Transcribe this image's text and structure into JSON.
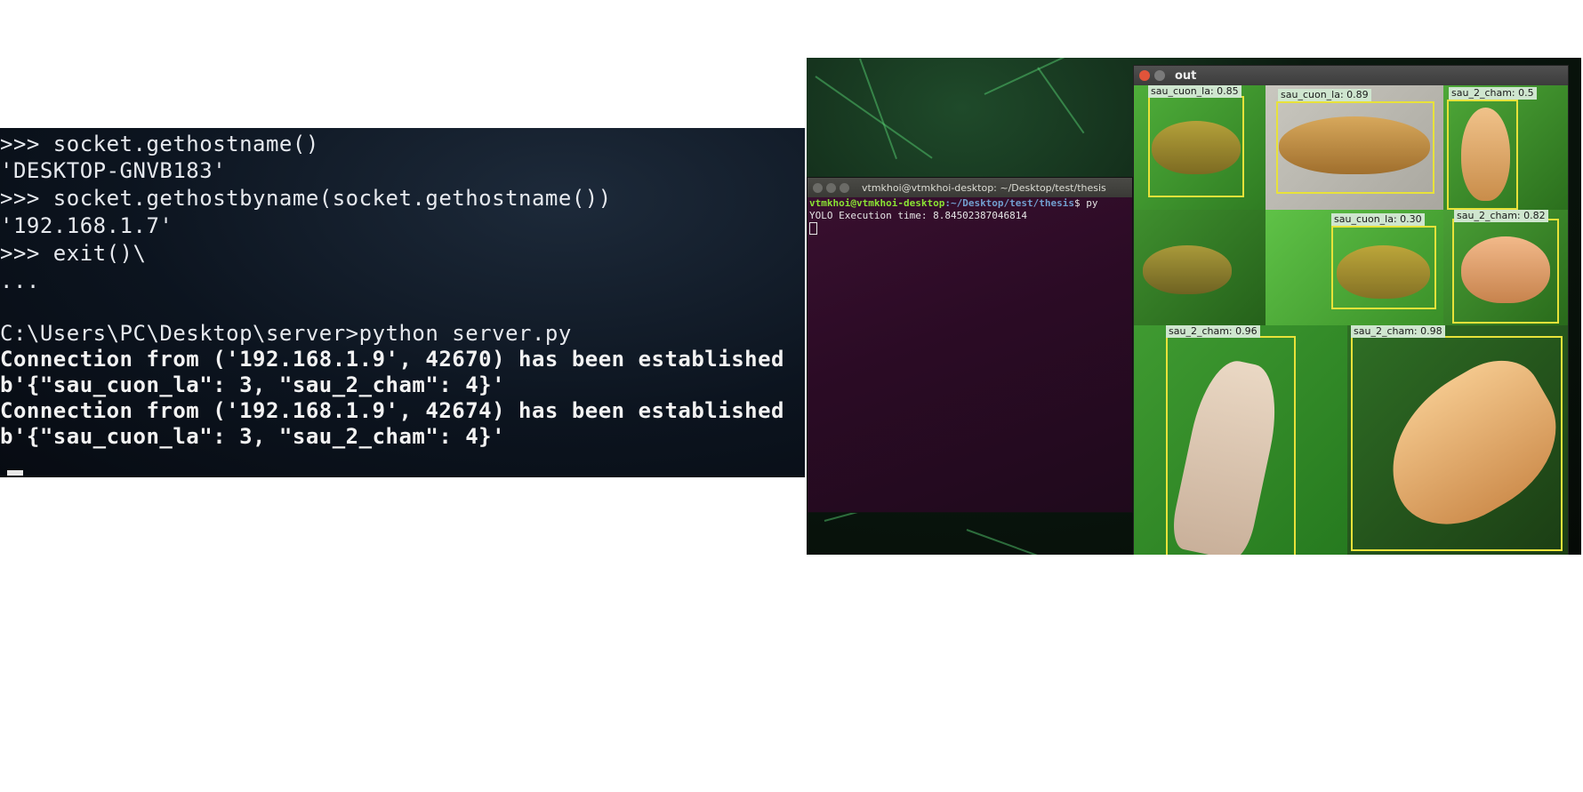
{
  "left_console": {
    "lines": [
      ">>> socket.gethostname()",
      "'DESKTOP-GNVB183'",
      ">>> socket.gethostbyname(socket.gethostname())",
      "'192.168.1.7'",
      ">>> exit()\\",
      "...",
      "",
      "C:\\Users\\PC\\Desktop\\server>python server.py",
      "Connection from ('192.168.1.9', 42670) has been established",
      "b'{\"sau_cuon_la\": 3, \"sau_2_cham\": 4}'",
      "Connection from ('192.168.1.9', 42674) has been established",
      "b'{\"sau_cuon_la\": 3, \"sau_2_cham\": 4}'"
    ]
  },
  "ubuntu_terminal": {
    "title": "vtmkhoi@vtmkhoi-desktop: ~/Desktop/test/thesis",
    "prompt_user": "vtmkhoi@vtmkhoi-desktop",
    "prompt_path": ":~/Desktop/test/thesis",
    "prompt_tail": "$ py",
    "output": "YOLO Execution time: 8.84502387046814"
  },
  "out_window": {
    "title": "out",
    "detections": [
      {
        "label": "sau_cuon_la: 0.85"
      },
      {
        "label": "sau_cuon_la: 0.89"
      },
      {
        "label": "sau_2_cham: 0.5"
      },
      {
        "label": "sau_cuon_la: 0.30"
      },
      {
        "label": "sau_2_cham: 0.82"
      },
      {
        "label": "sau_2_cham: 0.96"
      },
      {
        "label": "sau_2_cham: 0.98"
      }
    ]
  },
  "colors": {
    "console_bg": "#0c141f",
    "ubuntu_term_bg": "#2b0b25",
    "bbox": "#e8e23a",
    "prompt_user": "#8ae234",
    "prompt_path": "#729fcf"
  }
}
